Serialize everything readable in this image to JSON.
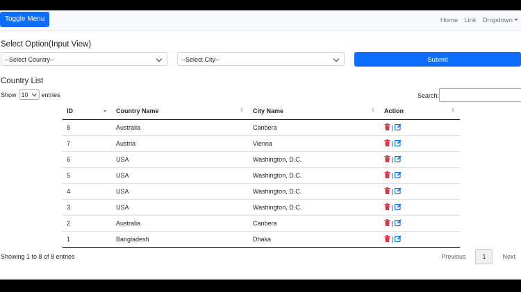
{
  "navbar": {
    "toggle_label": "Toggle Menu",
    "links": [
      "Home",
      "Link",
      "Dropdown"
    ]
  },
  "form": {
    "heading": "Select Option(Input View)",
    "country_select": "--Select Country--",
    "city_select": "--Select City--",
    "submit_label": "Submit"
  },
  "list": {
    "heading": "Country List",
    "show_label": "Show",
    "page_length": "10",
    "entries_label": "entries",
    "search_label": "Search:",
    "columns": [
      "ID",
      "Country Name",
      "City Name",
      "Action"
    ],
    "rows": [
      [
        "8",
        "Australia",
        "Canbera"
      ],
      [
        "7",
        "Austria",
        "Vienna"
      ],
      [
        "6",
        "USA",
        "Washington, D.C."
      ],
      [
        "5",
        "USA",
        "Washington, D.C."
      ],
      [
        "4",
        "USA",
        "Washington, D.C."
      ],
      [
        "3",
        "USA",
        "Washington, D.C."
      ],
      [
        "2",
        "Australia",
        "Canbera"
      ],
      [
        "1",
        "Bangladesh",
        "Dhaka"
      ]
    ],
    "action_separator": "|",
    "info": "Showing 1 to 8 of 8 entries",
    "pagination": {
      "previous": "Previous",
      "current_page": "1",
      "next": "Next"
    }
  },
  "icons": {
    "delete": "trash-icon",
    "edit": "edit-icon"
  },
  "colors": {
    "primary": "#0d6efd",
    "delete": "#dc3545",
    "edit": "#0d6efd"
  }
}
